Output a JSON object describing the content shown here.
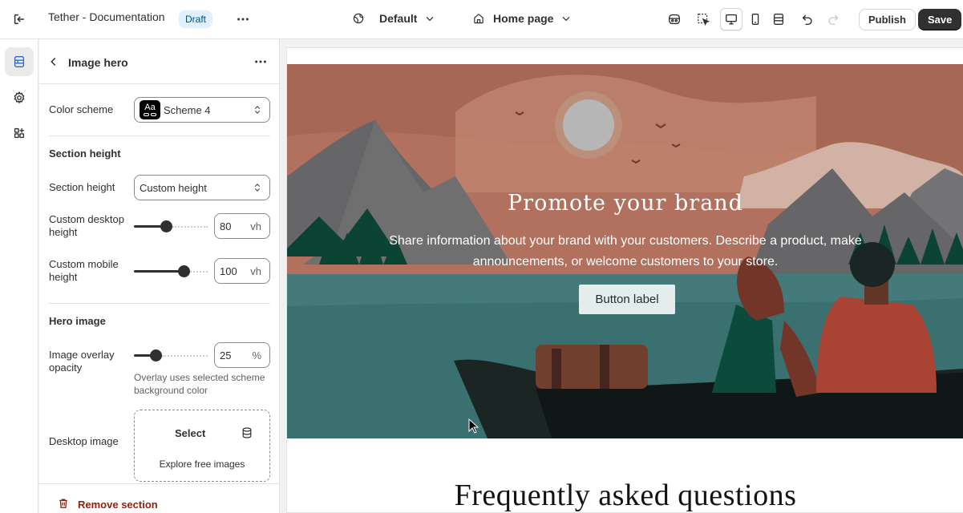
{
  "topbar": {
    "app_title": "Tether - Documentation",
    "status_badge": "Draft",
    "theme_dropdown": "Default",
    "page_dropdown": "Home page",
    "publish_label": "Publish",
    "save_label": "Save"
  },
  "panel": {
    "title": "Image hero",
    "color_scheme": {
      "label": "Color scheme",
      "value": "Scheme 4",
      "swatch_text": "Aa"
    },
    "section_height_heading": "Section height",
    "section_height": {
      "label": "Section height",
      "value": "Custom height"
    },
    "custom_desktop_height": {
      "label": "Custom desktop height",
      "value": "80",
      "unit": "vh",
      "slider_fraction": 0.44
    },
    "custom_mobile_height": {
      "label": "Custom mobile height",
      "value": "100",
      "unit": "vh",
      "slider_fraction": 0.67
    },
    "hero_image_heading": "Hero image",
    "image_overlay_opacity": {
      "label": "Image overlay opacity",
      "value": "25",
      "unit": "%",
      "slider_fraction": 0.29,
      "help": "Overlay uses selected scheme background color"
    },
    "desktop_image": {
      "label": "Desktop image",
      "select_label": "Select",
      "explore_label": "Explore free images"
    },
    "remove_section_label": "Remove section"
  },
  "preview": {
    "hero_title": "Promote your brand",
    "hero_text": "Share information about your brand with your customers. Describe a product, make announcements, or welcome customers to your store.",
    "hero_button": "Button label",
    "faq_title": "Frequently asked questions"
  },
  "colors": {
    "accent_dark": "#303030",
    "draft_badge_bg": "#e0f0ff",
    "remove_red": "#8e1f0b",
    "hero_sky": "#c9806a",
    "hero_water": "#3f7a7a"
  }
}
